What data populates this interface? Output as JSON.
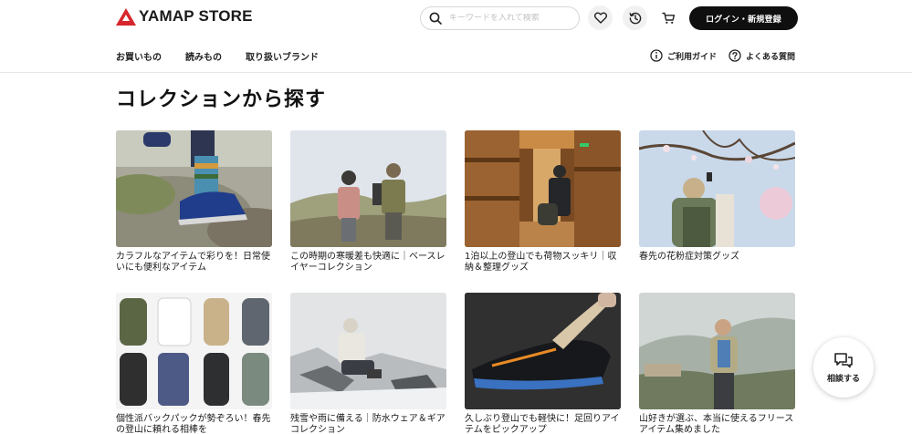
{
  "header": {
    "logo_text": "YAMAP STORE",
    "search_placeholder": "キーワードを入れて検索",
    "login_label": "ログイン・新規登録",
    "icons": [
      "search-icon",
      "heart-icon",
      "history-icon",
      "cart-icon"
    ]
  },
  "nav": {
    "left": [
      "お買いもの",
      "読みもの",
      "取り扱いブランド"
    ],
    "right": [
      {
        "icon": "info-icon",
        "label": "ご利用ガイド"
      },
      {
        "icon": "question-icon",
        "label": "よくある質問"
      }
    ]
  },
  "main": {
    "title": "コレクションから探す",
    "cards": [
      {
        "caption": "カラフルなアイテムで彩りを！日常使いにも便利なアイテム"
      },
      {
        "caption": "この時期の寒暖差も快適に｜ベースレイヤーコレクション"
      },
      {
        "caption": "1泊以上の登山でも荷物スッキリ｜収納＆整理グッズ"
      },
      {
        "caption": "春先の花粉症対策グッズ"
      },
      {
        "caption": "個性派バックパックが勢ぞろい！春先の登山に頼れる相棒を"
      },
      {
        "caption": "残雪や雨に備える｜防水ウェア＆ギアコレクション"
      },
      {
        "caption": "久しぶり登山でも軽快に！足回りアイテムをピックアップ"
      },
      {
        "caption": "山好きが選ぶ、本当に使えるフリースアイテム集めました"
      }
    ]
  },
  "consult": {
    "label": "相談する",
    "icon": "chat-icon"
  },
  "colors": {
    "accent": "#d7262c",
    "button_dark": "#0f0f0f"
  }
}
